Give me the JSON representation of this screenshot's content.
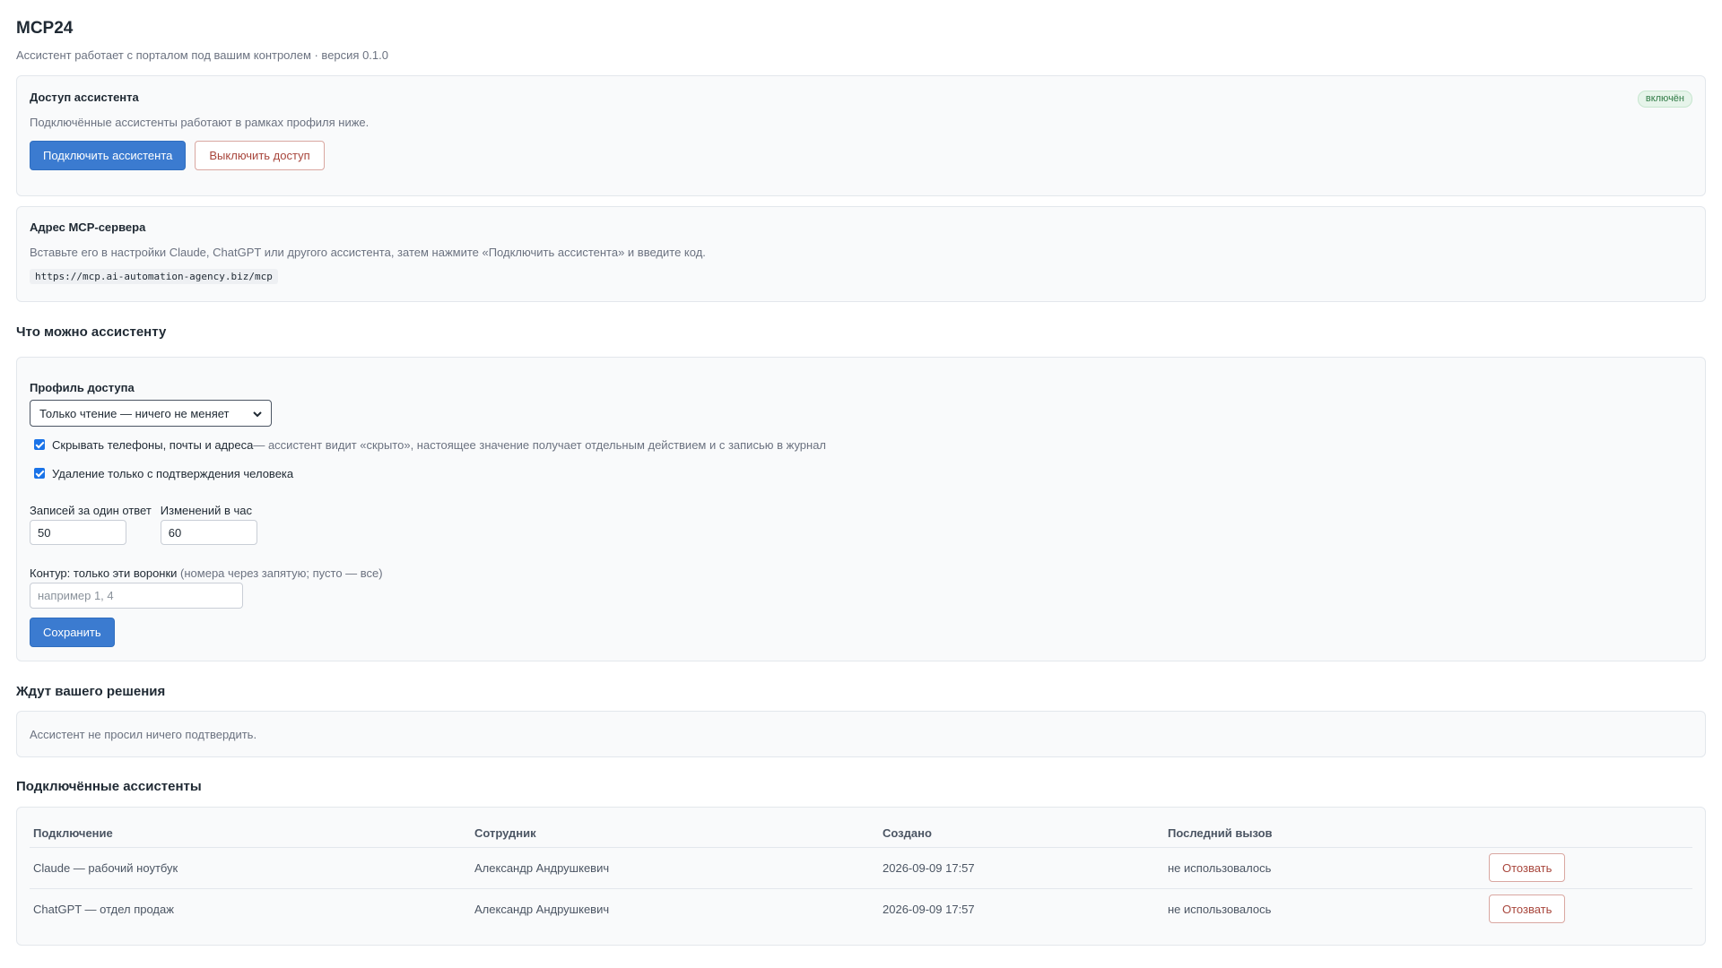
{
  "header": {
    "title": "MCP24",
    "subtitle": "Ассистент работает с порталом под вашим контролем · версия 0.1.0"
  },
  "access": {
    "title": "Доступ ассистента",
    "badge": "включён",
    "description": "Подключённые ассистенты работают в рамках профиля ниже.",
    "connect_button": "Подключить ассистента",
    "disable_button": "Выключить доступ"
  },
  "server": {
    "title": "Адрес MCP-сервера",
    "description": "Вставьте его в настройки Claude, ChatGPT или другого ассистента, затем нажмите «Подключить ассистента» и введите код.",
    "url": "https://mcp.ai-automation-agency.biz/mcp"
  },
  "permissions": {
    "heading": "Что можно ассистенту",
    "profile_label": "Профиль доступа",
    "profile_selected": "Только чтение — ничего не меняет",
    "hide_contacts_label": "Скрывать телефоны, почты и адреса",
    "hide_contacts_hint": " — ассистент видит «скрыто», настоящее значение получает отдельным действием и с записью в журнал",
    "hide_contacts_checked": true,
    "confirm_delete_label": "Удаление только с подтверждения человека",
    "confirm_delete_checked": true,
    "records_label": "Записей за один ответ",
    "records_value": "50",
    "changes_label": "Изменений в час",
    "changes_value": "60",
    "contour_label": "Контур: только эти воронки",
    "contour_hint": " (номера через запятую; пусто — все)",
    "contour_placeholder": "например 1, 4",
    "save_button": "Сохранить"
  },
  "pending": {
    "heading": "Ждут вашего решения",
    "empty_text": "Ассистент не просил ничего подтвердить."
  },
  "connected": {
    "heading": "Подключённые ассистенты",
    "columns": [
      "Подключение",
      "Сотрудник",
      "Создано",
      "Последний вызов"
    ],
    "rows": [
      {
        "name": "Claude — рабочий ноутбук",
        "employee": "Александр Андрушкевич",
        "created": "2026-09-09 17:57",
        "last_call": "не использовалось",
        "action": "Отозвать"
      },
      {
        "name": "ChatGPT — отдел продаж",
        "employee": "Александр Андрушкевич",
        "created": "2026-09-09 17:57",
        "last_call": "не использовалось",
        "action": "Отозвать"
      }
    ]
  }
}
